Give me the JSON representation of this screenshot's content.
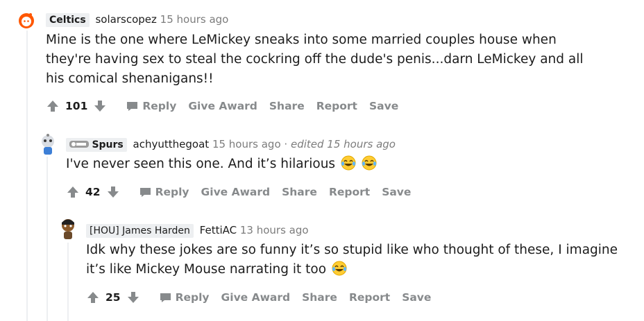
{
  "comments": [
    {
      "flair": "Celtics",
      "username": "solarscopez",
      "time": "15 hours ago",
      "edited": "",
      "body": "Mine is the one where LeMickey sneaks into some married couples house when they're having sex to steal the cockring off the dude's penis...darn LeMickey and all his comical shenanigans!!",
      "score": "101"
    },
    {
      "flair": "Spurs",
      "username": "achyutthegoat",
      "time": "15 hours ago",
      "separator": "·",
      "edited": "edited 15 hours ago",
      "body": "I've never seen this one. And it’s hilarious",
      "score": "42"
    },
    {
      "flair": "[HOU] James Harden",
      "username": "FettiAC",
      "time": "13 hours ago",
      "edited": "",
      "body_line1": "Idk why these jokes are so funny it’s so stupid like who thought of these, I imagine",
      "body_line2": "it’s like Mickey Mouse narrating it too",
      "score": "25"
    }
  ],
  "actions": {
    "reply": "Reply",
    "give_award": "Give Award",
    "share": "Share",
    "report": "Report",
    "save": "Save"
  },
  "icons": {
    "upvote": "upvote-arrow-icon",
    "downvote": "downvote-arrow-icon",
    "reply": "speech-bubble-icon",
    "emoji": "tears-of-joy-emoji"
  },
  "colors": {
    "meta": "#7c7c7c",
    "action": "#878a8c",
    "flair_bg": "#edeff1",
    "thread_line": "#edeff1"
  }
}
